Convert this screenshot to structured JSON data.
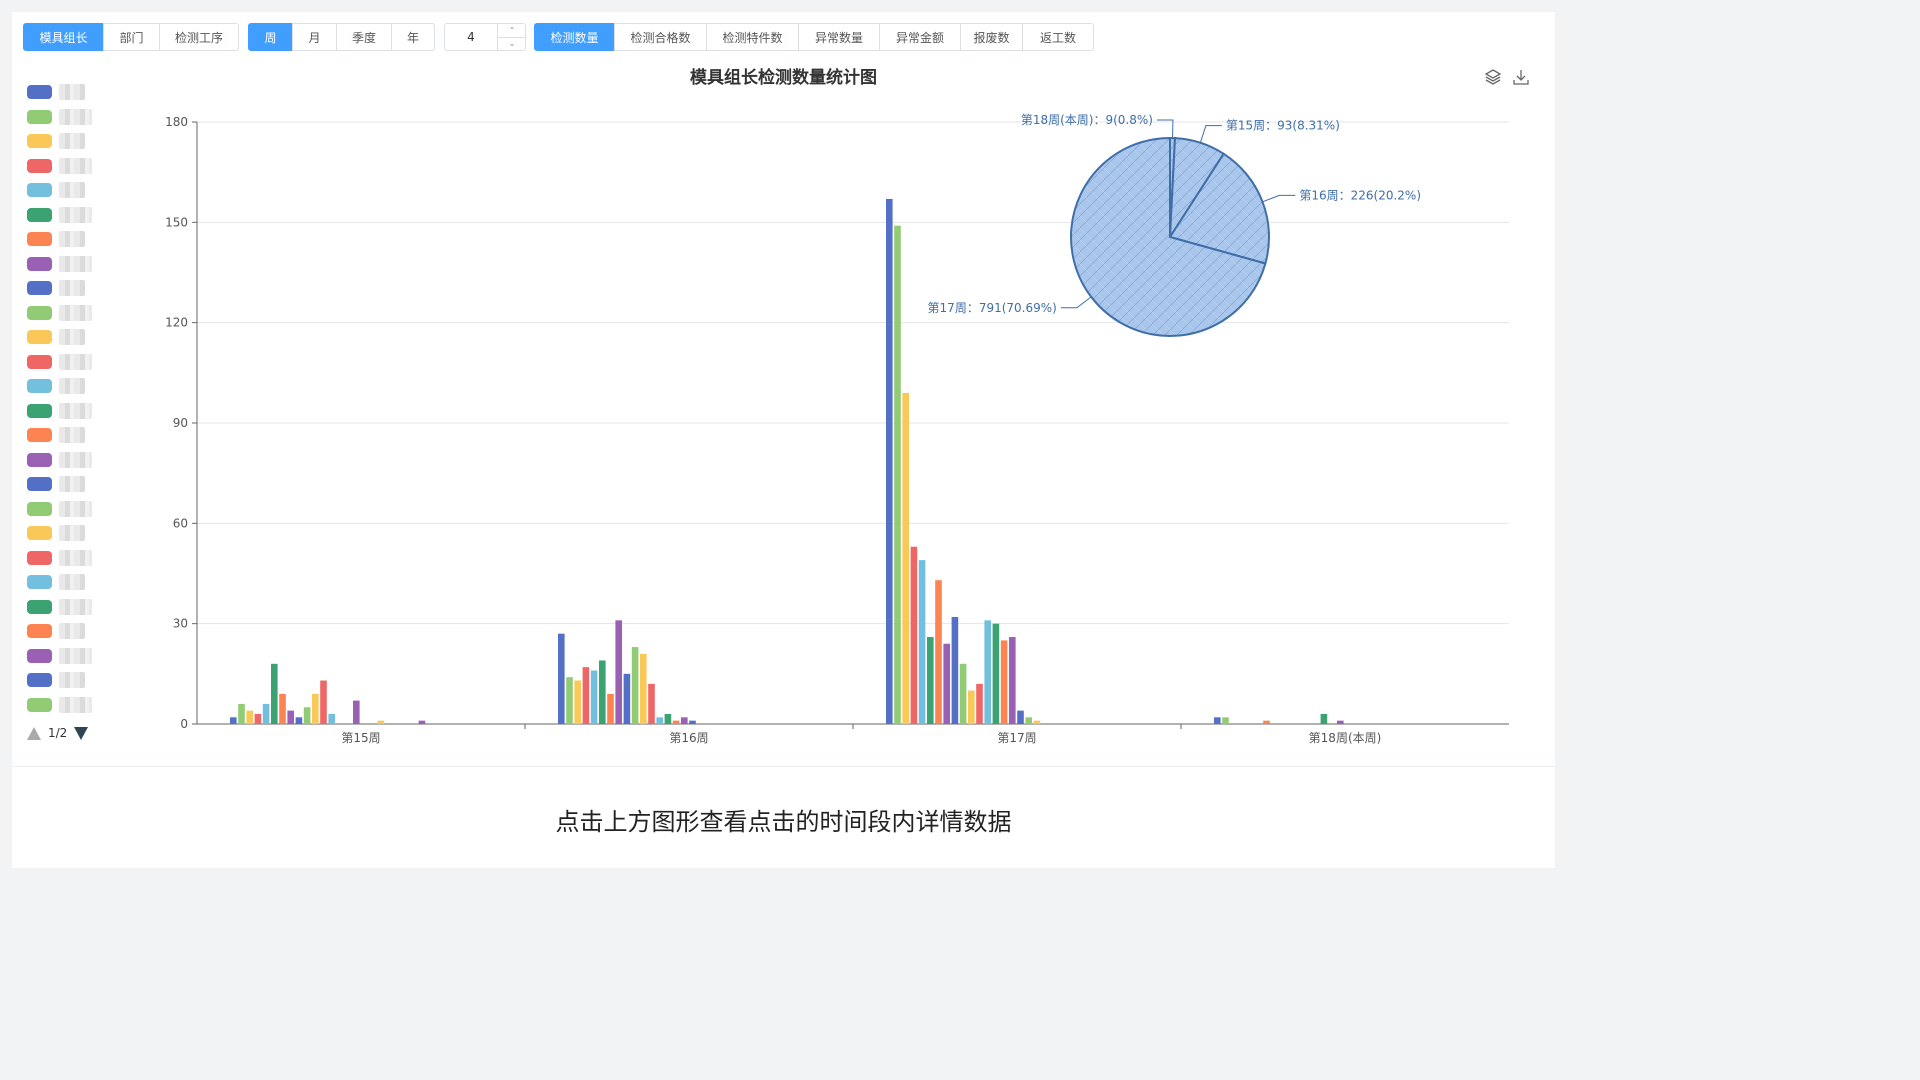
{
  "group_buttons": [
    {
      "label": "模具组长",
      "active": true
    },
    {
      "label": "部门",
      "active": false
    },
    {
      "label": "检测工序",
      "active": false
    }
  ],
  "period_buttons": [
    {
      "label": "周",
      "active": true
    },
    {
      "label": "月",
      "active": false
    },
    {
      "label": "季度",
      "active": false
    },
    {
      "label": "年",
      "active": false
    }
  ],
  "period_count": "4",
  "metric_buttons": [
    {
      "label": "检测数量",
      "active": true
    },
    {
      "label": "检测合格数",
      "active": false
    },
    {
      "label": "检测特件数",
      "active": false
    },
    {
      "label": "异常数量",
      "active": false
    },
    {
      "label": "异常金额",
      "active": false
    },
    {
      "label": "报废数",
      "active": false
    },
    {
      "label": "返工数",
      "active": false
    }
  ],
  "legend_colors": [
    "#5470c6",
    "#91cc75",
    "#fac858",
    "#ee6666",
    "#73c0de",
    "#3ba272",
    "#fc8452",
    "#9a60b4"
  ],
  "legend_count": 26,
  "legend_page": "1/2",
  "hint": "点击上方图形查看点击的时间段内详情数据",
  "chart_data": {
    "title": "模具组长检测数量统计图",
    "bar": {
      "type": "bar",
      "categories": [
        "第15周",
        "第16周",
        "第17周",
        "第18周(本周)"
      ],
      "ylim": [
        0,
        180
      ],
      "yticks": [
        0,
        30,
        60,
        90,
        120,
        150,
        180
      ],
      "grid": true,
      "legend": "left",
      "series_values": [
        [
          2,
          6,
          4,
          3,
          6,
          18,
          9,
          4,
          2,
          5,
          9,
          13,
          3,
          0,
          0,
          7,
          0,
          0,
          1,
          0,
          0,
          0,
          0,
          1
        ],
        [
          27,
          14,
          13,
          17,
          16,
          19,
          9,
          31,
          15,
          23,
          21,
          12,
          2,
          3,
          1,
          2,
          1
        ],
        [
          157,
          149,
          99,
          53,
          49,
          26,
          43,
          24,
          32,
          18,
          10,
          12,
          31,
          30,
          25,
          26,
          4,
          2,
          1
        ],
        [
          2,
          2,
          0,
          0,
          0,
          0,
          1,
          0,
          0,
          0,
          0,
          0,
          0,
          3,
          0,
          1
        ]
      ]
    },
    "pie": {
      "type": "pie",
      "slices": [
        {
          "label": "第15周：93(8.31%)",
          "value": 93
        },
        {
          "label": "第16周：226(20.2%)",
          "value": 226
        },
        {
          "label": "第17周：791(70.69%)",
          "value": 791
        },
        {
          "label": "第18周(本周)：9(0.8%)",
          "value": 9
        }
      ]
    }
  }
}
